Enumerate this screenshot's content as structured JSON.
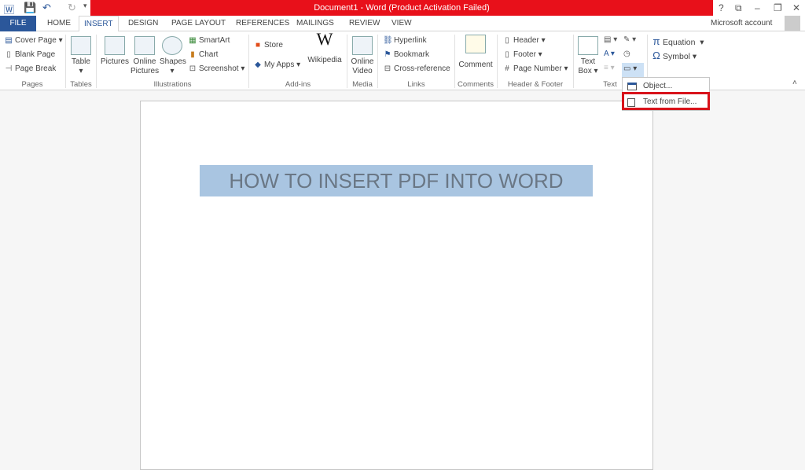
{
  "window": {
    "title": "Document1 - Word (Product Activation Failed)",
    "account": "Microsoft account",
    "controls": [
      "?",
      "⧉",
      "–",
      "❐",
      "✕"
    ]
  },
  "tabs": [
    "FILE",
    "HOME",
    "INSERT",
    "DESIGN",
    "PAGE LAYOUT",
    "REFERENCES",
    "MAILINGS",
    "REVIEW",
    "VIEW"
  ],
  "ribbon": {
    "pages": {
      "label": "Pages",
      "items": [
        "Cover Page",
        "Blank Page",
        "Page Break"
      ]
    },
    "tables": {
      "label": "Tables",
      "items": [
        "Table"
      ]
    },
    "illustrations": {
      "label": "Illustrations",
      "items": [
        "Pictures",
        "Online Pictures",
        "Shapes",
        "SmartArt",
        "Chart",
        "Screenshot"
      ]
    },
    "addins": {
      "label": "Add-ins",
      "items": [
        "Store",
        "My Apps",
        "Wikipedia"
      ]
    },
    "media": {
      "label": "Media",
      "items": [
        "Online Video"
      ]
    },
    "links": {
      "label": "Links",
      "items": [
        "Hyperlink",
        "Bookmark",
        "Cross-reference"
      ]
    },
    "comments": {
      "label": "Comments",
      "items": [
        "Comment"
      ]
    },
    "header_footer": {
      "label": "Header & Footer",
      "items": [
        "Header",
        "Footer",
        "Page Number"
      ]
    },
    "text": {
      "label": "Text",
      "items": [
        "Text Box"
      ]
    },
    "symbols": {
      "items": [
        "Equation",
        "Symbol"
      ]
    }
  },
  "object_menu": {
    "items": [
      "Object...",
      "Text from File..."
    ],
    "highlighted": "Text from File...",
    "highlight_color": "#d8131b"
  },
  "document": {
    "title": "HOW TO INSERT PDF INTO WORD"
  }
}
